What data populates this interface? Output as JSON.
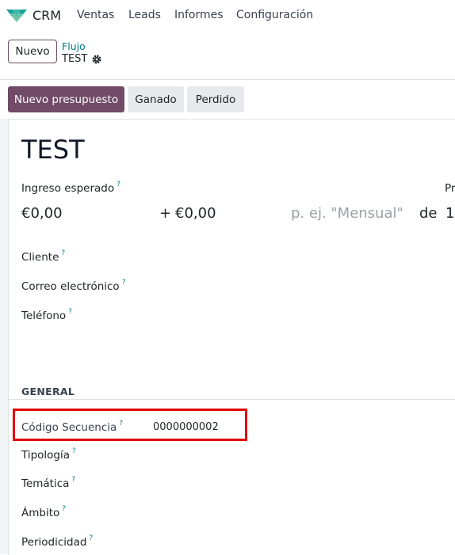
{
  "navbar": {
    "app_name": "CRM",
    "menu": [
      "Ventas",
      "Leads",
      "Informes",
      "Configuración"
    ]
  },
  "control_panel": {
    "new_button": "Nuevo",
    "breadcrumb_parent": "Flujo",
    "breadcrumb_current": "TEST"
  },
  "statusbar": {
    "primary": "Nuevo presupuesto",
    "won": "Ganado",
    "lost": "Perdido"
  },
  "form": {
    "title": "TEST",
    "expected_revenue_label": "Ingreso esperado",
    "expected_revenue": "€0,00",
    "plus_sign": "+",
    "recurring_revenue": "€0,00",
    "recurring_plan_placeholder": "p. ej. \"Mensual\"",
    "de_label": "de",
    "right_cut_value": "1",
    "right_cut_label": "Pr",
    "customer_label": "Cliente",
    "email_label": "Correo electrónico",
    "phone_label": "Teléfono",
    "tooltip_mark": "?"
  },
  "general": {
    "section_title": "GENERAL",
    "sequence_label": "Código Secuencia",
    "sequence_value": "0000000002",
    "tipologia_label": "Tipología",
    "tematica_label": "Temática",
    "ambito_label": "Ámbito",
    "periodicidad_label": "Periodicidad"
  },
  "colors": {
    "brand": "#714b67",
    "link": "#017e84",
    "highlight": "#e00000"
  },
  "icons": [
    "crm-logo-icon",
    "gear-icon"
  ]
}
